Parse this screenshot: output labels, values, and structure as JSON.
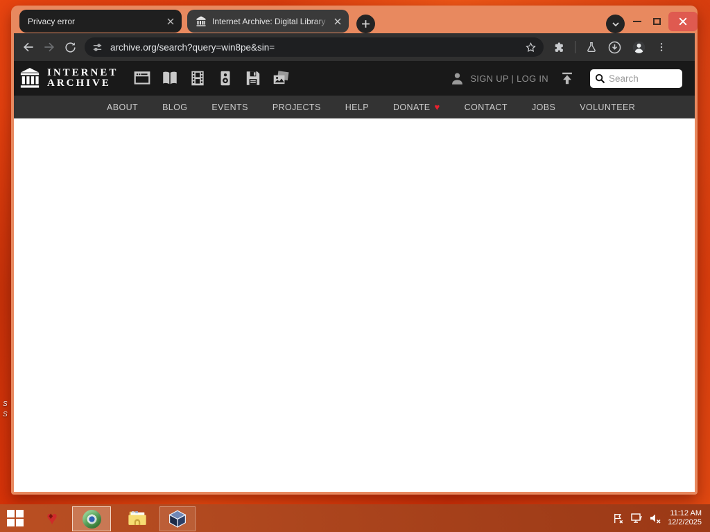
{
  "desktop": {
    "icon_labels": [
      "S",
      "S"
    ]
  },
  "browser": {
    "tabs": [
      {
        "title": "Privacy error",
        "active": false
      },
      {
        "title": "Internet Archive: Digital Library",
        "active": true
      }
    ],
    "url": "archive.org/search?query=win8pe&sin="
  },
  "ia": {
    "logo_line1": "INTERNET",
    "logo_line2": "ARCHIVE",
    "auth_text": "SIGN UP | LOG IN",
    "search_placeholder": "Search",
    "nav": [
      "ABOUT",
      "BLOG",
      "EVENTS",
      "PROJECTS",
      "HELP",
      "DONATE",
      "CONTACT",
      "JOBS",
      "VOLUNTEER"
    ],
    "media_type_icons": [
      "web-icon",
      "texts-icon",
      "video-icon",
      "audio-icon",
      "software-icon",
      "images-icon"
    ]
  },
  "taskbar": {
    "time": "11:12 AM",
    "date": "12/2/2025"
  },
  "colors": {
    "window_frame": "#e8895f",
    "desktop_base": "#d93a0e",
    "toolbar": "#303030",
    "ia_header": "#191919",
    "ia_nav": "#333333",
    "donate_heart": "#e8212e",
    "close_button": "#df5a50",
    "taskbar": "#a8431f"
  }
}
